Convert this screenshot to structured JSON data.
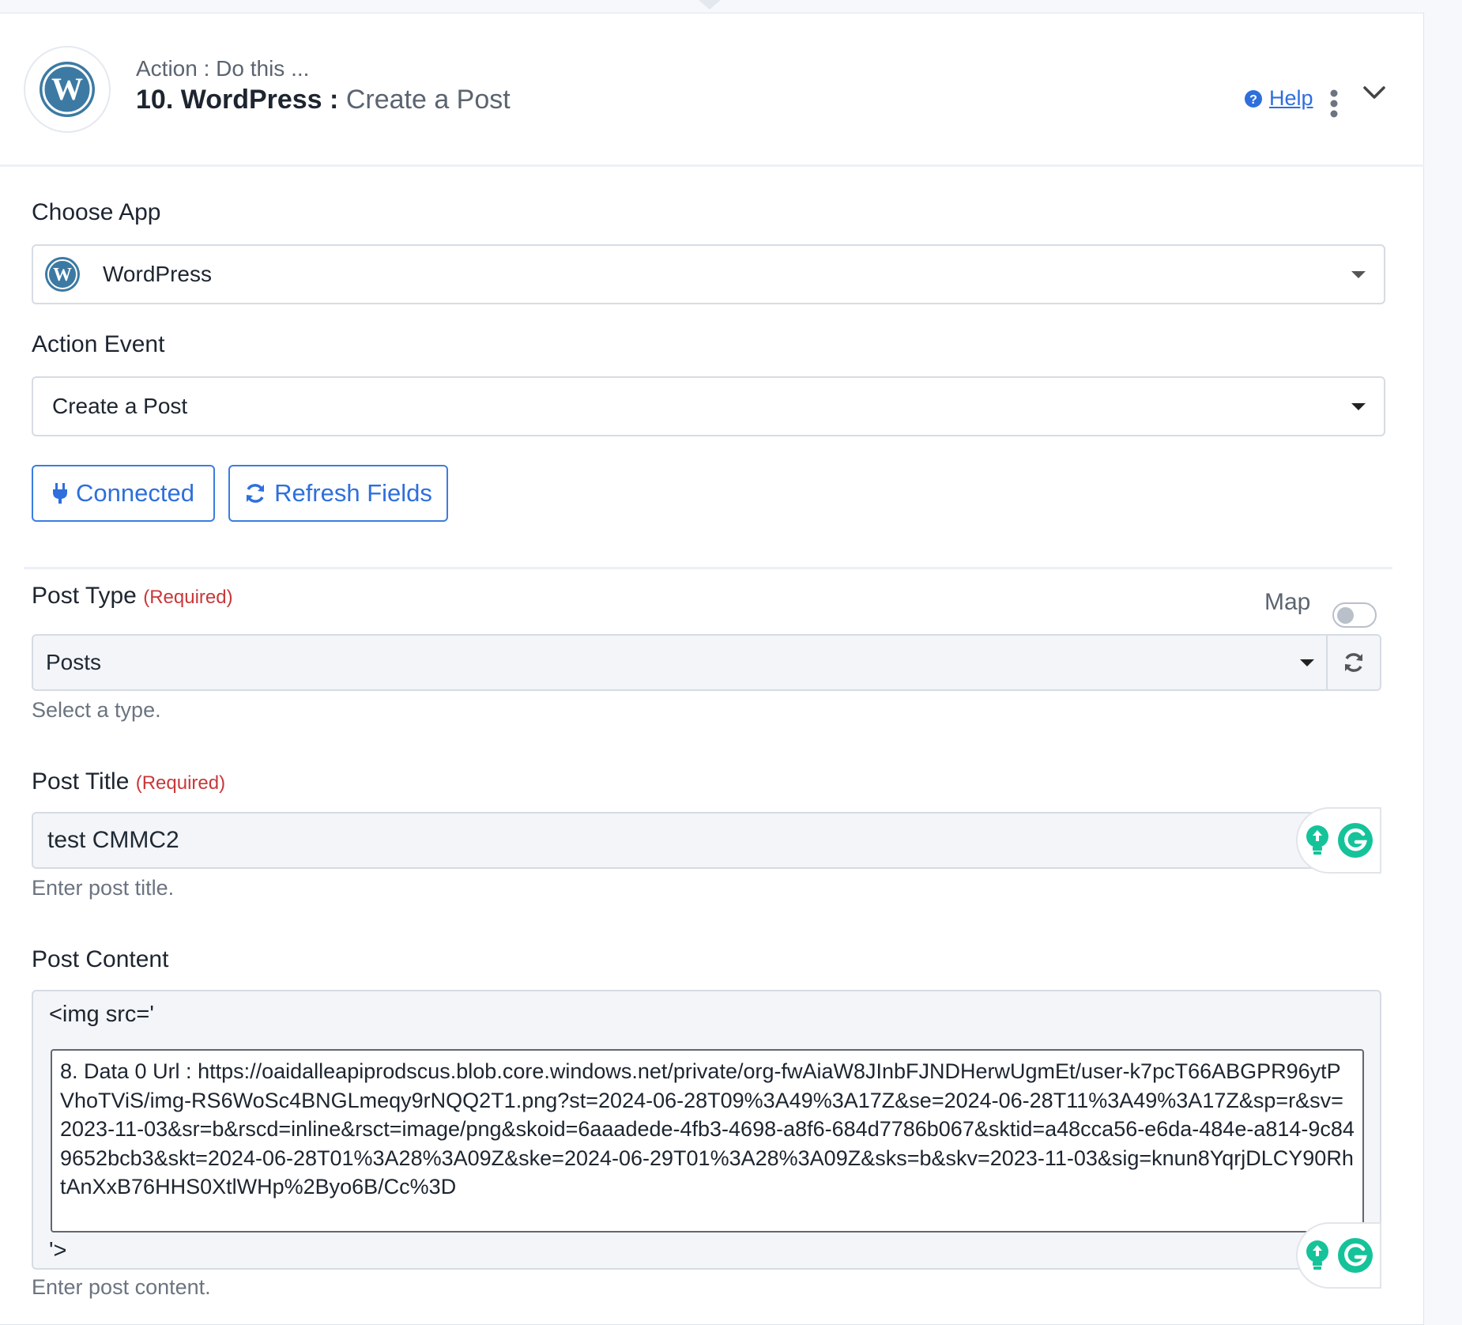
{
  "header": {
    "subtitle": "Action : Do this ...",
    "step_title": "10. WordPress :",
    "step_event": "Create a Post",
    "help_label": "Help"
  },
  "choose_app": {
    "label": "Choose App",
    "value": "WordPress"
  },
  "action_event": {
    "label": "Action Event",
    "value": "Create a Post"
  },
  "buttons": {
    "connected": "Connected",
    "refresh": "Refresh Fields"
  },
  "post_type": {
    "label": "Post Type",
    "required": "(Required)",
    "map_label": "Map",
    "value": "Posts",
    "hint": "Select a type."
  },
  "post_title": {
    "label": "Post Title",
    "required": "(Required)",
    "value": "test CMMC2",
    "hint": "Enter post title."
  },
  "post_content": {
    "label": "Post Content",
    "prefix": "<img src='",
    "mapped_value": "8. Data 0 Url : https://oaidalleapiprodscus.blob.core.windows.net/private/org-fwAiaW8JInbFJNDHerwUgmEt/user-k7pcT66ABGPR96ytPVhoTViS/img-RS6WoSc4BNGLmeqy9rNQQ2T1.png?st=2024-06-28T09%3A49%3A17Z&se=2024-06-28T11%3A49%3A17Z&sp=r&sv=2023-11-03&sr=b&rscd=inline&rsct=image/png&skoid=6aaadede-4fb3-4698-a8f6-684d7786b067&sktid=a48cca56-e6da-484e-a814-9c849652bcb3&skt=2024-06-28T01%3A28%3A09Z&ske=2024-06-29T01%3A28%3A09Z&sks=b&skv=2023-11-03&sig=knun8YqrjDLCY90RhtAnXxB76HHS0XtlWHp%2Byo6B/Cc%3D",
    "suffix": "'>",
    "hint": "Enter post content."
  },
  "colors": {
    "accent": "#2e6fdc",
    "required": "#c9373a",
    "wordpress": "#3c7aa3",
    "grammarly": "#15c39a"
  }
}
